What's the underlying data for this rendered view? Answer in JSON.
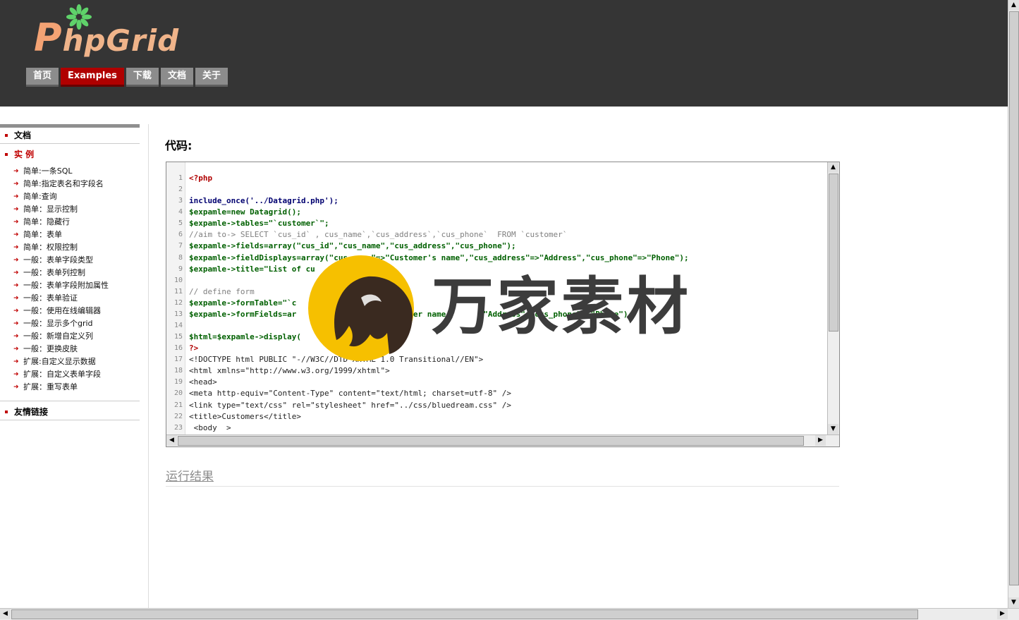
{
  "logo": {
    "text": "PHPGRID"
  },
  "nav": {
    "items": [
      {
        "label": "首页"
      },
      {
        "label": "Examples",
        "active": true
      },
      {
        "label": "下载"
      },
      {
        "label": "文档"
      },
      {
        "label": "关于"
      }
    ]
  },
  "sidebar": {
    "docs_heading": "文档",
    "examples_heading": "实 例",
    "examples": [
      "简单:一条SQL",
      "简单:指定表名和字段名",
      "简单:查询",
      "简单：显示控制",
      "简单：隐藏行",
      "简单：表单",
      "简单：权限控制",
      "一般：表单字段类型",
      "一般：表单列控制",
      "一般：表单字段附加属性",
      "一般：表单验证",
      "一般：使用在线编辑器",
      "一般：显示多个grid",
      "一般：新增自定义列",
      "一般：更换皮肤",
      "扩展:自定义显示数据",
      "扩展：自定义表单字段",
      "扩展：重写表单"
    ],
    "links_heading": "友情链接"
  },
  "main": {
    "code_title": "代码:",
    "result_title": "运行结果"
  },
  "code": {
    "line_numbers": [
      "1",
      "2",
      "3",
      "4",
      "5",
      "6",
      "7",
      "8",
      "9",
      "10",
      "11",
      "12",
      "13",
      "14",
      "15",
      "16",
      "17",
      "18",
      "19",
      "20",
      "21",
      "22",
      "23"
    ],
    "lines": [
      "<?php",
      "",
      "include_once('../Datagrid.php');",
      "$expamle=new Datagrid();",
      "$expamle->tables=\"`customer`\";",
      "//aim to-> SELECT `cus_id` , cus_name`,`cus_address`,`cus_phone`  FROM `customer`",
      "$expamle->fields=array(\"cus_id\",\"cus_name\",\"cus_address\",\"cus_phone\");",
      "$expamle->fieldDisplays=array(\"cus_name\"=>\"Customer's name\",\"cus_address\"=>\"Address\",\"cus_phone\"=>\"Phone\");",
      "$expamle->title=\"List of cu",
      "",
      "// define form",
      "$expamle->formTable=\"`c",
      "$expamle->formFields=ar                      tomer name        \"Address\"  cus_phone\"=>\"Phone\");",
      "",
      "$html=$expamle->display(",
      "?>",
      "<!DOCTYPE html PUBLIC \"-//W3C//DTD XHTML 1.0 Transitional//EN\">",
      "<html xmlns=\"http://www.w3.org/1999/xhtml\">",
      "<head>",
      "<meta http-equiv=\"Content-Type\" content=\"text/html; charset=utf-8\" />",
      "<link type=\"text/css\" rel=\"stylesheet\" href=\"../css/bluedream.css\" />",
      "<title>Customers</title>",
      " <body  >"
    ]
  },
  "watermark": {
    "text": "万家素材"
  },
  "colors": {
    "header_bg": "#353535",
    "nav_active": "#b00000",
    "nav_item": "#8c8c8c",
    "accent_red": "#c00000"
  }
}
